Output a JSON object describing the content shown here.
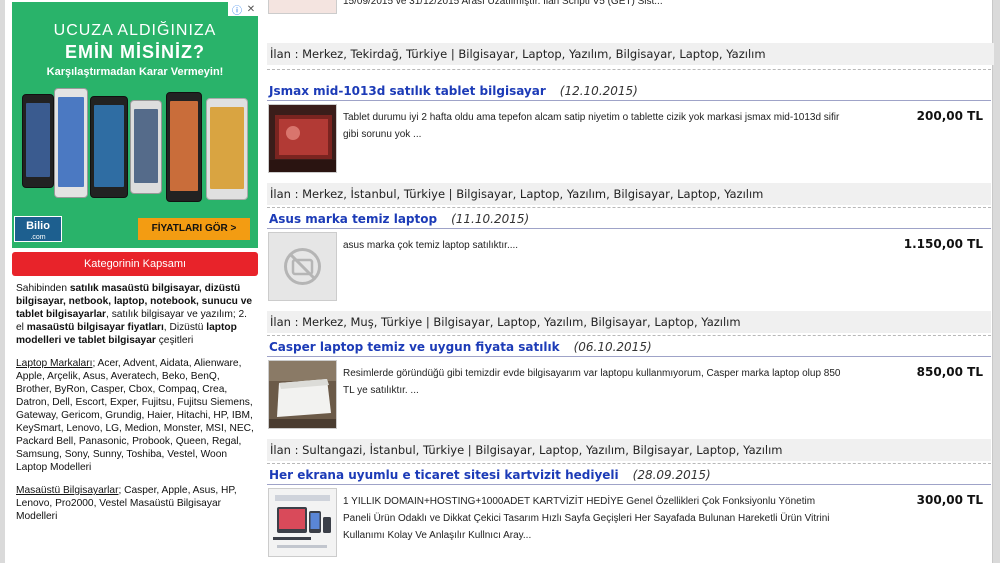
{
  "ad": {
    "badge_info": "ⓘ",
    "badge_close": "✕",
    "line1": "UCUZA ALDIĞINIZA",
    "line2": "EMİN MİSİNİZ?",
    "line3": "Karşılaştırmadan Karar Vermeyin!",
    "logo": "Bilio",
    "logo_sub": ".com",
    "cta": "FİYATLARI GÖR >"
  },
  "category": {
    "header": "Kategorinin Kapsamı",
    "intro_1": "Sahibinden ",
    "intro_b1": "satılık masaüstü bilgisayar, dizüstü bilgisayar, netbook, laptop, notebook, sunucu ve tablet bilgisayarlar",
    "intro_2": ", satılık bilgisayar ve yazılım; 2. el ",
    "intro_b2": "masaüstü bilgisayar fiyatları",
    "intro_3": ", Dizüstü ",
    "intro_b3": "laptop modelleri ve tablet bilgisayar",
    "intro_4": " çeşitleri",
    "laptop_label": "Laptop Markaları",
    "laptop_list": "; Acer, Advent, Aidata, Alienware, Apple, Arçelik, Asus, Averatech, Beko, BenQ, Brother, ByRon, Casper, Cbox, Compaq, Crea, Datron, Dell, Escort, Exper, Fujitsu, Fujitsu Siemens, Gateway, Gericom, Grundig, Haier, Hitachi, HP, IBM, KeySmart, Lenovo, LG, Medion, Monster, MSI, NEC, Packard Bell, Panasonic, Probook, Queen, Regal, Samsung, Sony, Sunny, Toshiba, Vestel, Woon Laptop Modelleri",
    "desktop_label": "Masaüstü Bilgisayarlar",
    "desktop_list": "; Casper, Apple, Asus, HP, Lenovo, Pro2000, Vestel Masaüstü Bilgisayar Modelleri"
  },
  "top_partial": {
    "desc": "15/09/2015 ve 31/12/2015 Arası Uzatılmıştır. İlan Scripti V5 (GET) Sist...",
    "meta": "İlan : Merkez, Tekirdağ, Türkiye | Bilgisayar, Laptop, Yazılım, Bilgisayar, Laptop, Yazılım"
  },
  "listings": [
    {
      "title": "Jsmax mid-1013d satılık tablet bilgisayar",
      "date": "(12.10.2015)",
      "desc": "Tablet durumu iyi 2 hafta oldu ama tepefon alcam satip niyetim o tablette cizik yok markasi jsmax mid-1013d sifir gibi sorunu yok ...",
      "price": "200,00 TL",
      "meta": "İlan : Merkez, İstanbul, Türkiye | Bilgisayar, Laptop, Yazılım, Bilgisayar, Laptop, Yazılım"
    },
    {
      "title": "Asus marka temiz laptop",
      "date": "(11.10.2015)",
      "desc": "asus marka çok temiz laptop satılıktır....",
      "price": "1.150,00 TL",
      "meta": "İlan : Merkez, Muş, Türkiye | Bilgisayar, Laptop, Yazılım, Bilgisayar, Laptop, Yazılım"
    },
    {
      "title": "Casper laptop temiz ve uygun fiyata satılık",
      "date": "(06.10.2015)",
      "desc": "Resimlerde göründüğü gibi temizdir evde bilgisayarım var laptopu kullanmıyorum, Casper marka laptop olup 850 TL ye satılıktır. ...",
      "price": "850,00 TL",
      "meta": "İlan : Sultangazi, İstanbul, Türkiye | Bilgisayar, Laptop, Yazılım, Bilgisayar, Laptop, Yazılım"
    },
    {
      "title": "Her ekrana uyumlu e ticaret sitesi kartvizit hediyeli",
      "date": "(28.09.2015)",
      "desc": "1 YILLIK DOMAIN+HOSTING+1000ADET KARTVİZİT HEDİYE Genel Özellikleri Çok Fonksiyonlu Yönetim Paneli Ürün Odaklı ve Dikkat Çekici Tasarım Hızlı Sayfa Geçişleri Her Sayafada Bulunan Hareketli Ürün Vitrini Kullanımı Kolay Ve Anlaşılır Kullnıcı Aray...",
      "price": "300,00 TL",
      "meta": ""
    }
  ],
  "colors": {
    "title_blue": "#1c3bb7",
    "header_red": "#e8232a",
    "ad_green": "#29b36a",
    "cta_orange": "#f39c12"
  }
}
